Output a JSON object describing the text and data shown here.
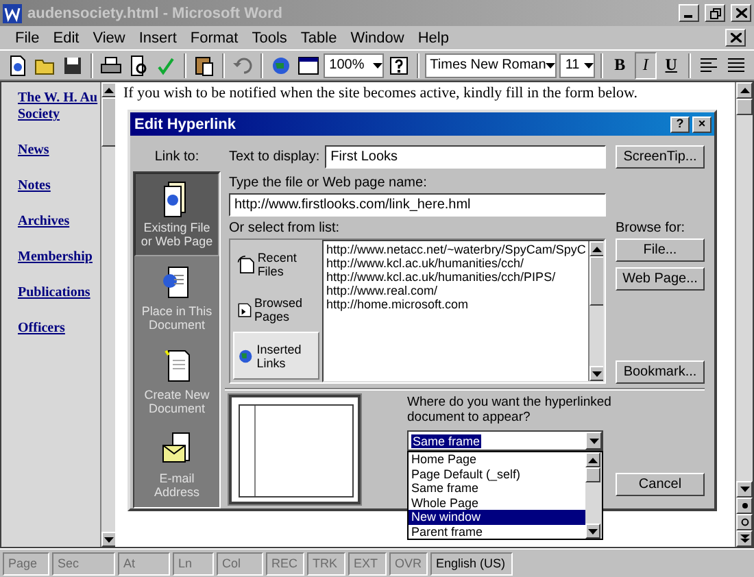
{
  "window": {
    "title": "audensociety.html - Microsoft Word",
    "active": false
  },
  "menu": [
    "File",
    "Edit",
    "View",
    "Insert",
    "Format",
    "Tools",
    "Table",
    "Window",
    "Help"
  ],
  "toolbar": {
    "zoom": "100%",
    "font": "Times New Roman",
    "size": "11",
    "bold": "B",
    "italic": "I",
    "underline": "U",
    "undo_disabled": true
  },
  "nav_links": [
    "The W. H. Au",
    "Society",
    "News",
    "Notes",
    "Archives",
    "Membership",
    "Publications",
    "Officers"
  ],
  "document_text": "If you wish to be notified when the site becomes active, kindly fill in the form below.",
  "dialog": {
    "title": "Edit Hyperlink",
    "help": "?",
    "close": "×",
    "link_to_label": "Link to:",
    "link_to": [
      {
        "label": "Existing File or Web Page",
        "selected": true,
        "kind": "web"
      },
      {
        "label": "Place in This Document",
        "selected": false,
        "kind": "place"
      },
      {
        "label": "Create New Document",
        "selected": false,
        "kind": "new"
      },
      {
        "label": "E-mail Address",
        "selected": false,
        "kind": "mail"
      }
    ],
    "text_to_display_label": "Text to display:",
    "text_to_display": "First Looks",
    "screentip_button": "ScreenTip...",
    "file_label": "Type the file or Web page name:",
    "file_value": "http://www.firstlooks.com/link_here.hml",
    "list_label": "Or select from list:",
    "browse_label": "Browse for:",
    "list_tabs": [
      {
        "label": "Recent Files",
        "selected": false,
        "kind": "recent"
      },
      {
        "label": "Browsed Pages",
        "selected": false,
        "kind": "browsed"
      },
      {
        "label": "Inserted Links",
        "selected": true,
        "kind": "links"
      }
    ],
    "urls": [
      "http://www.netacc.net/~waterbry/SpyCam/SpyC",
      "http://www.kcl.ac.uk/humanities/cch/",
      "http://www.kcl.ac.uk/humanities/cch/PIPS/",
      "http://www.real.com/",
      "http://home.microsoft.com"
    ],
    "browse_buttons": [
      "File...",
      "Web Page..."
    ],
    "bookmark_button": "Bookmark...",
    "target_question": "Where do you want the hyperlinked document to appear?",
    "target_value": "Same frame",
    "target_options": [
      {
        "label": "Home Page",
        "selected": false
      },
      {
        "label": "Page Default (_self)",
        "selected": false
      },
      {
        "label": "Same frame",
        "selected": false
      },
      {
        "label": "Whole Page",
        "selected": false
      },
      {
        "label": "New window",
        "selected": true
      },
      {
        "label": "Parent frame",
        "selected": false
      }
    ],
    "cancel_button": "Cancel"
  },
  "status_bar": [
    {
      "text": "Page",
      "disabled": true
    },
    {
      "text": "Sec",
      "disabled": true
    },
    {
      "text": "At",
      "disabled": true
    },
    {
      "text": "Ln",
      "disabled": true
    },
    {
      "text": "Col",
      "disabled": true
    },
    {
      "text": "REC",
      "disabled": true
    },
    {
      "text": "TRK",
      "disabled": true
    },
    {
      "text": "EXT",
      "disabled": true
    },
    {
      "text": "OVR",
      "disabled": true
    },
    {
      "text": "English (US)",
      "disabled": false
    }
  ]
}
